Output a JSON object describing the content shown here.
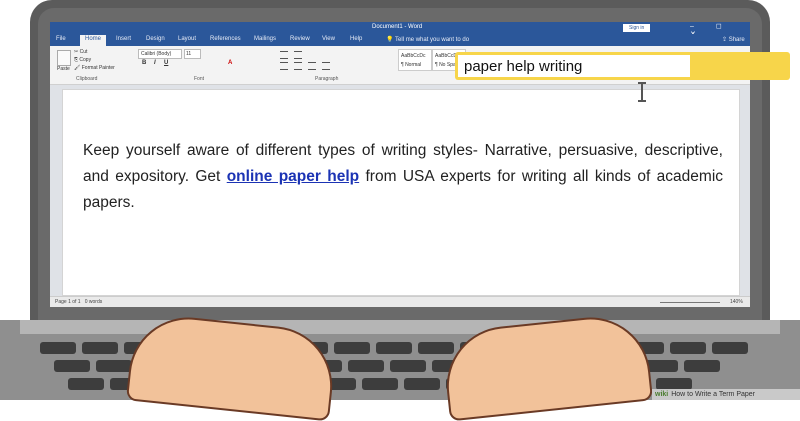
{
  "window": {
    "title": "Document1 - Word",
    "signin_label": "Sign in",
    "controls": "–  ◻  ✕"
  },
  "tabs": [
    "File",
    "Home",
    "Insert",
    "Design",
    "Layout",
    "References",
    "Mailings",
    "Review",
    "View",
    "Help"
  ],
  "tell_me": "Tell me what you want to do",
  "share_label": "Share",
  "ribbon": {
    "paste_label": "Paste",
    "cut_label": "Cut",
    "copy_label": "Copy",
    "format_painter_label": "Format Painter",
    "clipboard_group": "Clipboard",
    "font_name": "Calibri (Body)",
    "font_size": "11",
    "font_group": "Font",
    "paragraph_group": "Paragraph",
    "style_preview_1": "AaBbCcDc",
    "style_preview_2": "AaBbCcDc",
    "style_name_1": "¶ Normal",
    "style_name_2": "¶ No Spac..."
  },
  "document": {
    "text_before_link": "Keep yourself aware of different types of writing styles- Narrative, persuasive, descriptive, and expository. Get ",
    "link_text": "online paper help",
    "text_after_link": " from USA experts for writing all kinds of academic papers."
  },
  "statusbar": {
    "page_info": "Page 1 of 1",
    "word_count": "0 words",
    "zoom": "140%"
  },
  "search": {
    "value": "paper help writing"
  },
  "watermark": {
    "brand": "wiki",
    "text": "How to Write a Term Paper"
  },
  "colors": {
    "word_blue": "#2b579a",
    "highlight_yellow": "#f7d54a",
    "link_blue": "#1b33b4"
  }
}
